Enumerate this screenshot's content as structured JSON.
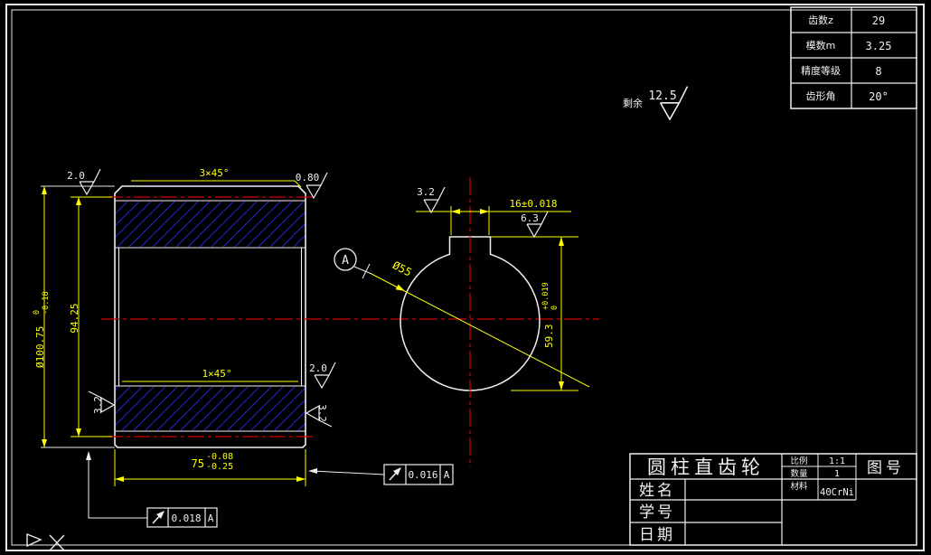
{
  "annotations": {
    "rest_label": "剩余",
    "rest_roughness": "12.5"
  },
  "param_table": {
    "rows": [
      {
        "label": "齿数z",
        "value": "29"
      },
      {
        "label": "模数m",
        "value": "3.25"
      },
      {
        "label": "精度等级",
        "value": "8"
      },
      {
        "label": "齿形角",
        "value": "20°"
      }
    ]
  },
  "title_block": {
    "title": "圆柱直齿轮",
    "scale_label": "比例",
    "scale_value": "1:1",
    "quantity_label": "数量",
    "quantity_value": "1",
    "material_label": "材料",
    "material_value": "40CrNi",
    "drawing_no_label": "图号",
    "name_label": "姓名",
    "student_no_label": "学号",
    "date_label": "日期"
  },
  "dimensions": {
    "outer_diameter": {
      "value": "Ø100.75",
      "tol_upper": "0",
      "tol_lower": "-0.18"
    },
    "pitch_width": "94.25",
    "face_width": {
      "value": "75",
      "tol_upper": "-0.08",
      "tol_lower": "-0.25"
    },
    "chamfer_outer": "3×45°",
    "chamfer_bore": "1×45°",
    "keyway_width": "16±0.018",
    "keyway_depth": {
      "value": "59.3",
      "tol_upper": "+0.019",
      "tol_lower": "0"
    },
    "bore_diameter": "Ø55",
    "datum_label": "A"
  },
  "roughness": {
    "top_left": "2.0",
    "top_right": "0.80",
    "left_face": "3.2",
    "right_face": "3.2",
    "bore_bottom": "2.0",
    "keyway_side": "3.2",
    "keyway_top": "6.3"
  },
  "feature_control": {
    "frame_top": {
      "value": "0.016",
      "datum": "A"
    },
    "frame_bottom": {
      "value": "0.018",
      "datum": "A"
    }
  },
  "colors": {
    "dimension": "#ffff00",
    "centerline": "#d40000",
    "hatch": "#2424cc",
    "line": "#f0f0f0"
  }
}
